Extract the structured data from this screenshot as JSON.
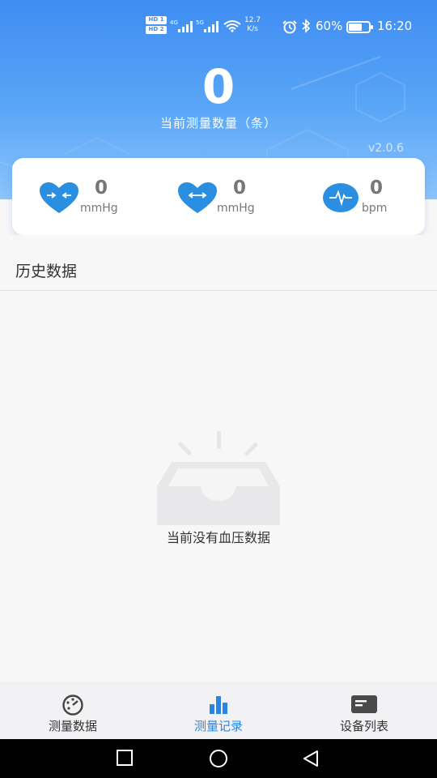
{
  "status_bar": {
    "hd1": "HD 1",
    "hd2": "HD 2",
    "net1": "4G",
    "net2": "5G",
    "speed_value": "12.7",
    "speed_unit": "K/s",
    "battery": "60%",
    "time": "16:20"
  },
  "summary": {
    "count": "0",
    "count_label": "当前测量数量（条）",
    "version": "v2.0.6"
  },
  "metrics": [
    {
      "icon": "heart-compress-icon",
      "value": "0",
      "unit": "mmHg"
    },
    {
      "icon": "heart-expand-icon",
      "value": "0",
      "unit": "mmHg"
    },
    {
      "icon": "pulse-icon",
      "value": "0",
      "unit": "bpm"
    }
  ],
  "history": {
    "title": "历史数据",
    "empty_text": "当前没有血压数据"
  },
  "nav": {
    "tabs": [
      {
        "label": "测量数据",
        "icon": "gauge-icon",
        "active": false
      },
      {
        "label": "测量记录",
        "icon": "bar-chart-icon",
        "active": true
      },
      {
        "label": "设备列表",
        "icon": "device-icon",
        "active": false
      }
    ]
  },
  "colors": {
    "accent": "#2a84e0",
    "header_top": "#3f8df3",
    "header_bottom": "#8cc4fb",
    "icon_blue": "#2a8fe0"
  }
}
